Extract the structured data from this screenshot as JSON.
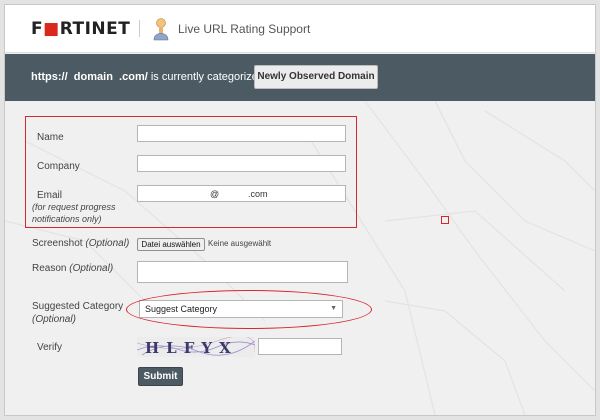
{
  "header": {
    "logo": {
      "prefix": "F",
      "accent": "■",
      "rest": "RTINET"
    },
    "app_title": "Live URL Rating Support",
    "app_icon": "user-icon"
  },
  "banner": {
    "url_scheme": "https://",
    "url_domain": "domain",
    "url_tld": ".com/",
    "status_text": "is currently categorized as",
    "category_button": "Newly Observed Domain"
  },
  "form": {
    "name_label": "Name",
    "company_label": "Company",
    "email_label": "Email",
    "email_note_line1": "(for request progress",
    "email_note_line2": "notifications only)",
    "email_at": "@",
    "email_domain": ".com",
    "screenshot_label": "Screenshot",
    "screenshot_optional": "(Optional)",
    "file_button": "Datei auswählen",
    "file_status": "Keine ausgewählt",
    "reason_label": "Reason",
    "reason_optional": "(Optional)",
    "suggested_label": "Suggested Category",
    "suggested_optional": "(Optional)",
    "suggested_select_value": "Suggest Category",
    "verify_label": "Verify",
    "captcha_text": "HLFYX",
    "submit_button": "Submit"
  },
  "colors": {
    "banner_bg": "#4c5b63",
    "brand_red": "#da291c",
    "annotation_red": "#d8262e",
    "page_bg": "#f0f0f0"
  }
}
